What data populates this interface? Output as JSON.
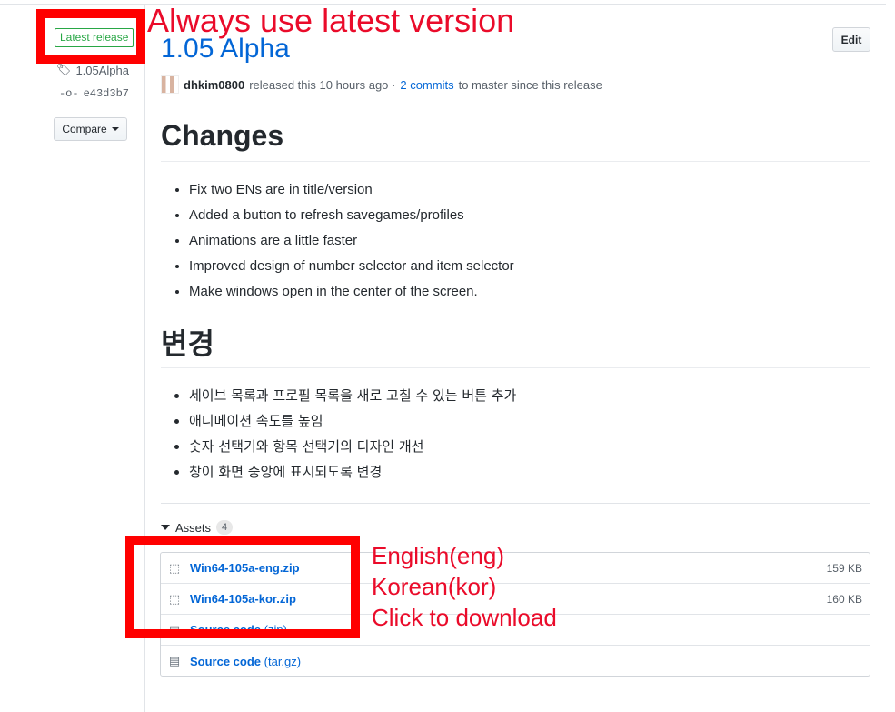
{
  "release": {
    "latest_badge": "Latest release",
    "tag": "1.05Alpha",
    "commit": "e43d3b7",
    "compare_label": "Compare",
    "title": "1.05 Alpha",
    "edit_label": "Edit",
    "author": "dhkim0800",
    "released_text": "released this 10 hours ago ·",
    "commits_link": "2 commits",
    "since_text": "to master since this release"
  },
  "notes": {
    "en_heading": "Changes",
    "en_items": [
      "Fix two ENs are in title/version",
      "Added a button to refresh savegames/profiles",
      "Animations are a little faster",
      "Improved design of number selector and item selector",
      "Make windows open in the center of the screen."
    ],
    "ko_heading": "변경",
    "ko_items": [
      "세이브 목록과 프로필 목록을 새로 고칠 수 있는 버튼 추가",
      "애니메이션 속도를 높임",
      "숫자 선택기와 항목 선택기의 디자인 개선",
      "창이 화면 중앙에 표시되도록 변경"
    ]
  },
  "assets": {
    "label": "Assets",
    "count": "4",
    "items": [
      {
        "name": "Win64-105a-eng.zip",
        "suffix": "",
        "size": "159 KB",
        "icon": "package-icon"
      },
      {
        "name": "Win64-105a-kor.zip",
        "suffix": "",
        "size": "160 KB",
        "icon": "package-icon"
      },
      {
        "name": "Source code",
        "suffix": " (zip)",
        "size": "",
        "icon": "file-zip-icon"
      },
      {
        "name": "Source code",
        "suffix": " (tar.gz)",
        "size": "",
        "icon": "file-zip-icon"
      }
    ]
  },
  "annotations": {
    "top": "Always use latest version",
    "eng": "English(eng)",
    "kor": "Korean(kor)",
    "click": "Click to download",
    "color": "#ea0b2a"
  }
}
